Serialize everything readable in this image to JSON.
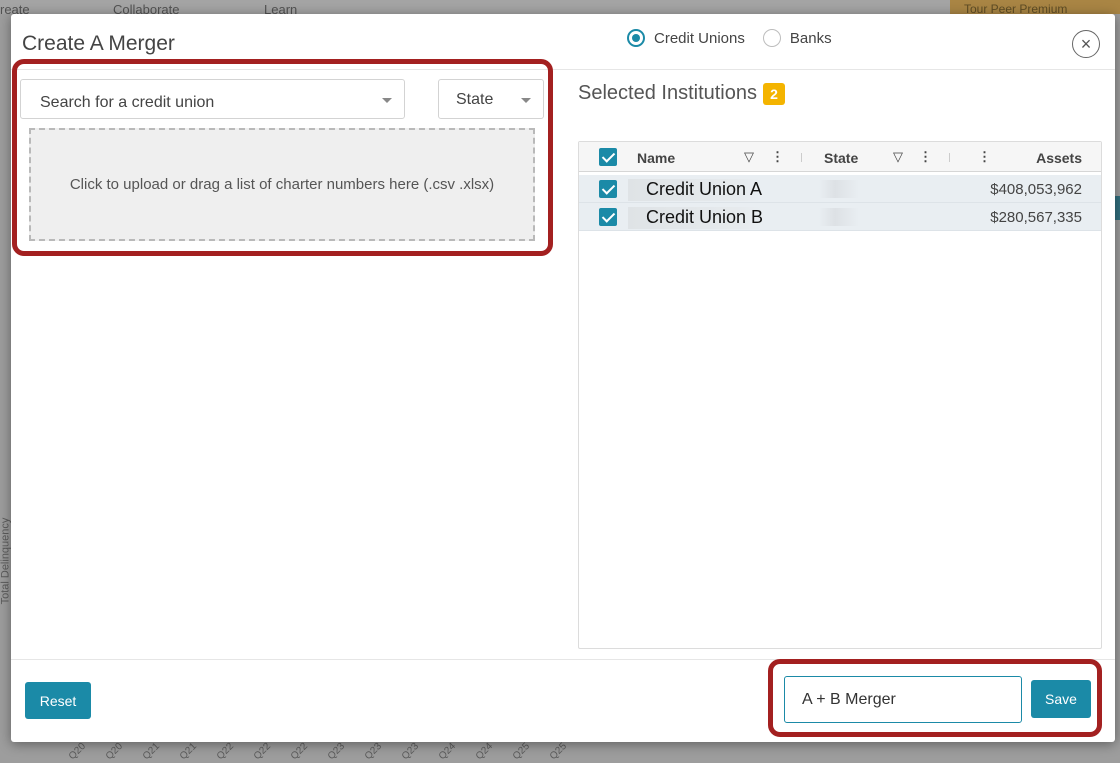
{
  "background": {
    "nav": [
      "reate",
      "Collaborate",
      "Learn"
    ],
    "premium_label": "Tour Peer Premium",
    "y_axis_label": "Total Delinquency",
    "x_ticks": [
      "Q20",
      "Q20",
      "Q21",
      "Q21",
      "Q22",
      "Q22",
      "Q22",
      "Q23",
      "Q23",
      "Q23",
      "Q24",
      "Q24",
      "Q25",
      "Q25"
    ]
  },
  "modal": {
    "title": "Create A Merger",
    "institution_types": [
      {
        "label": "Credit Unions",
        "selected": true
      },
      {
        "label": "Banks",
        "selected": false
      }
    ],
    "close_symbol": "×"
  },
  "left": {
    "search_placeholder": "Search for a credit union",
    "state_label": "State",
    "dropzone_text": "Click to upload or drag a list of charter numbers here (.csv .xlsx)"
  },
  "right": {
    "title": "Selected Institutions",
    "count": "2",
    "columns": {
      "name": "Name",
      "state": "State",
      "assets": "Assets"
    },
    "rows": [
      {
        "name": "Credit Union A",
        "state": "",
        "assets": "$408,053,962",
        "checked": true
      },
      {
        "name": "Credit Union B",
        "state": "",
        "assets": "$280,567,335",
        "checked": true
      }
    ]
  },
  "footer": {
    "reset_label": "Reset",
    "merger_name_value": "A + B Merger",
    "save_label": "Save"
  },
  "colors": {
    "accent": "#1b8aa7",
    "badge": "#f4b400",
    "highlight": "#a32020"
  }
}
